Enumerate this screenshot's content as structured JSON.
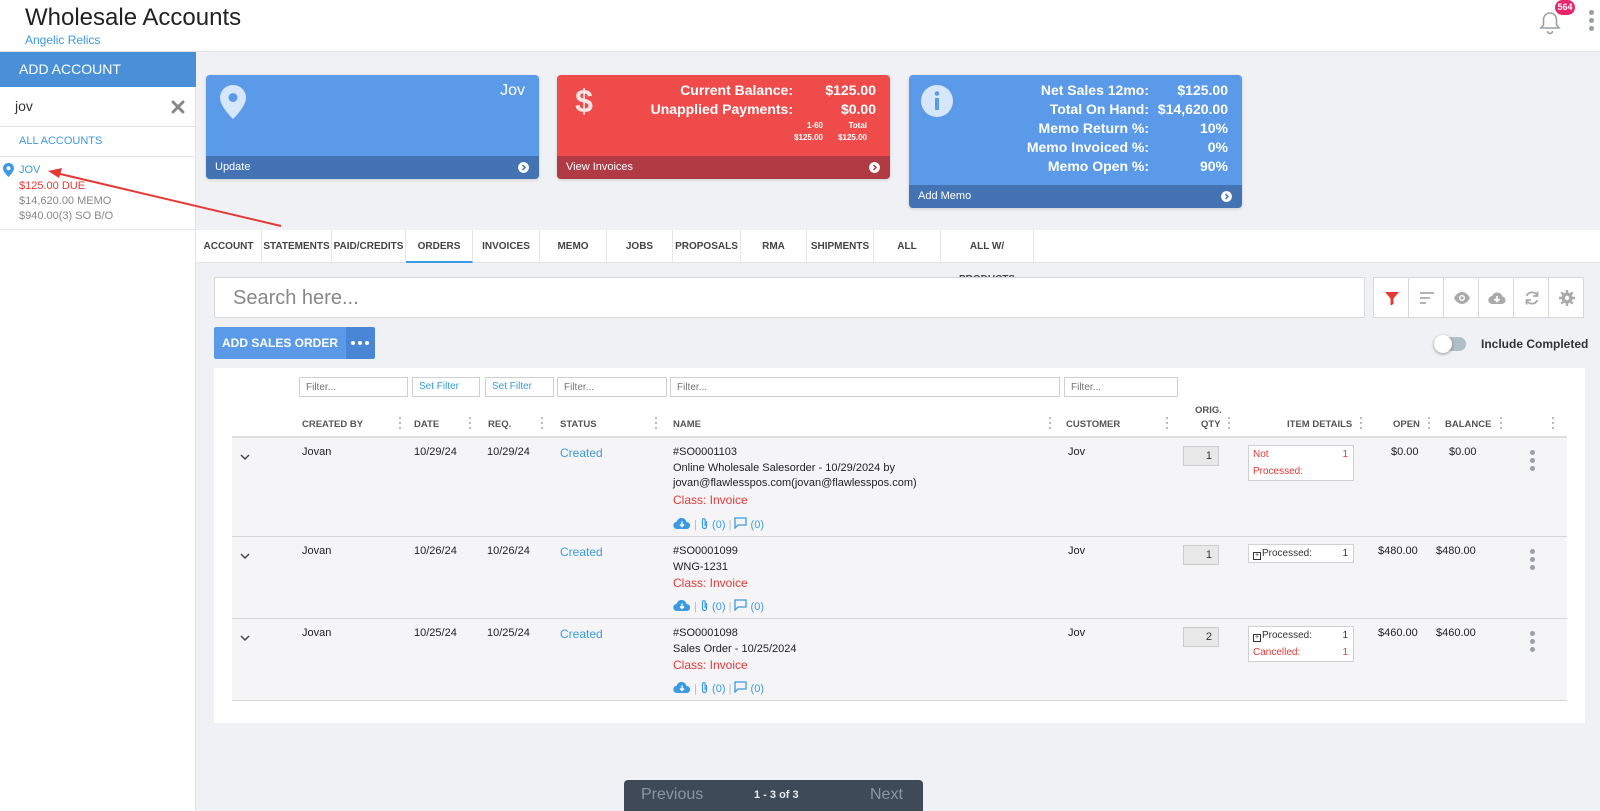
{
  "header": {
    "title": "Wholesale Accounts",
    "subtitle": "Angelic Relics",
    "notification_count": "564"
  },
  "sidebar": {
    "add_account_label": "ADD ACCOUNT",
    "search_value": "jov",
    "all_accounts_label": "ALL ACCOUNTS",
    "account": {
      "name": "JOV",
      "due": "$125.00 DUE",
      "memo": "$14,620.00 MEMO",
      "so_bo": "$940.00(3) SO B/O"
    }
  },
  "cards": {
    "account_card": {
      "name": "Jov",
      "footer": "Update"
    },
    "balance_card": {
      "current_balance_label": "Current Balance:",
      "current_balance_value": "$125.00",
      "unapplied_label": "Unapplied Payments:",
      "unapplied_value": "$0.00",
      "aging_label_1": "1-60",
      "aging_label_2": "Total",
      "aging_value_1": "$125.00",
      "aging_value_2": "$125.00",
      "footer": "View Invoices"
    },
    "memo_card": {
      "rows": [
        {
          "label": "Net Sales 12mo:",
          "value": "$125.00"
        },
        {
          "label": "Total On Hand:",
          "value": "$14,620.00"
        },
        {
          "label": "Memo Return %:",
          "value": "10%"
        },
        {
          "label": "Memo Invoiced %:",
          "value": "0%"
        },
        {
          "label": "Memo Open %:",
          "value": "90%"
        }
      ],
      "footer": "Add Memo"
    }
  },
  "tabs": [
    "ACCOUNT",
    "STATEMENTS",
    "PAID/CREDITS",
    "ORDERS",
    "INVOICES",
    "MEMO",
    "JOBS",
    "PROPOSALS",
    "RMA",
    "SHIPMENTS",
    "ALL",
    "ALL W/ PRODUCTS"
  ],
  "active_tab": "ORDERS",
  "search": {
    "placeholder": "Search here..."
  },
  "toolbar": {
    "icons": [
      "filter-icon",
      "sort-icon",
      "eye-icon",
      "cloud-download-icon",
      "refresh-icon",
      "gear-icon"
    ]
  },
  "add_sales_order_label": "ADD SALES ORDER",
  "include_completed_label": "Include Completed",
  "filters": {
    "filter_placeholder": "Filter...",
    "set_filter": "Set Filter"
  },
  "table": {
    "headers": {
      "created_by": "CREATED BY",
      "date": "DATE",
      "req": "REQ.",
      "status": "STATUS",
      "name": "NAME",
      "customer": "CUSTOMER",
      "orig": "ORIG.",
      "qty": "QTY",
      "item_details": "ITEM DETAILS",
      "open": "OPEN",
      "balance": "BALANCE"
    },
    "rows": [
      {
        "created_by": "Jovan",
        "date": "10/29/24",
        "req": "10/29/24",
        "status": "Created",
        "so": "#SO0001103",
        "desc1": "Online Wholesale Salesorder - 10/29/2024 by",
        "desc2": "jovan@flawlesspos.com(jovan@flawlesspos.com)",
        "class": "Class: Invoice",
        "attachments": "(0)",
        "comments": "(0)",
        "customer": "Jov",
        "qty": "1",
        "det1_label": "Not",
        "det1_value": "1",
        "det1b_label": "Processed:",
        "open": "$0.00",
        "balance": "$0.00"
      },
      {
        "created_by": "Jovan",
        "date": "10/26/24",
        "req": "10/26/24",
        "status": "Created",
        "so": "#SO0001099",
        "desc1": "WNG-1231",
        "class": "Class: Invoice",
        "attachments": "(0)",
        "comments": "(0)",
        "customer": "Jov",
        "qty": "1",
        "det1_label": "Processed:",
        "det1_value": "1",
        "open": "$480.00",
        "balance": "$480.00"
      },
      {
        "created_by": "Jovan",
        "date": "10/25/24",
        "req": "10/25/24",
        "status": "Created",
        "so": "#SO0001098",
        "desc1": "Sales Order - 10/25/2024",
        "class": "Class: Invoice",
        "attachments": "(0)",
        "comments": "(0)",
        "customer": "Jov",
        "qty": "2",
        "det1_label": "Processed:",
        "det1_value": "1",
        "det2_label": "Cancelled:",
        "det2_value": "1",
        "open": "$460.00",
        "balance": "$460.00"
      }
    ]
  },
  "pager": {
    "previous": "Previous",
    "count": "1 - 3 of 3",
    "next": "Next"
  },
  "colors": {
    "accent": "#3b9ae1",
    "blue_card": "#5b9ae8",
    "red_card": "#ef4b4b",
    "danger": "#e53935"
  }
}
